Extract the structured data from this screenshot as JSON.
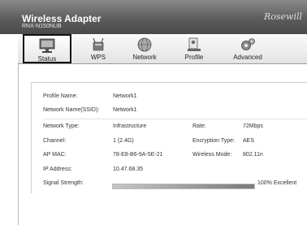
{
  "header": {
    "title": "Wireless Adapter",
    "subtitle": "RNX-N150NUB",
    "logo": "Rosewill"
  },
  "tabs": [
    {
      "label": "Status",
      "icon": "monitor-icon",
      "active": true
    },
    {
      "label": "WPS",
      "icon": "wps-icon",
      "active": false
    },
    {
      "label": "Network",
      "icon": "globe-icon",
      "active": false
    },
    {
      "label": "Profile",
      "icon": "profile-icon",
      "active": false
    },
    {
      "label": "Advanced",
      "icon": "gear-icon",
      "active": false
    }
  ],
  "status": {
    "profile_name_label": "Profile Name:",
    "profile_name_value": "Network1",
    "ssid_label": "Network Name(SSID):",
    "ssid_value": "Network1",
    "network_type_label": "Network Type:",
    "network_type_value": "Infrastructure",
    "rate_label": "Rate:",
    "rate_value": "72Mbps",
    "channel_label": "Channel:",
    "channel_value": "1 (2.4G)",
    "encryption_label": "Encryption Type:",
    "encryption_value": "AES",
    "ap_mac_label": "AP MAC:",
    "ap_mac_value": "78-E8-B6-9A-5E-21",
    "wireless_mode_label": "Wireless Mode:",
    "wireless_mode_value": "802.11n",
    "ip_label": "IP Address:",
    "ip_value": "10.47.68.35",
    "signal_label": "Signal Strength:",
    "signal_percent": 100,
    "signal_text": "100% Excellent"
  }
}
